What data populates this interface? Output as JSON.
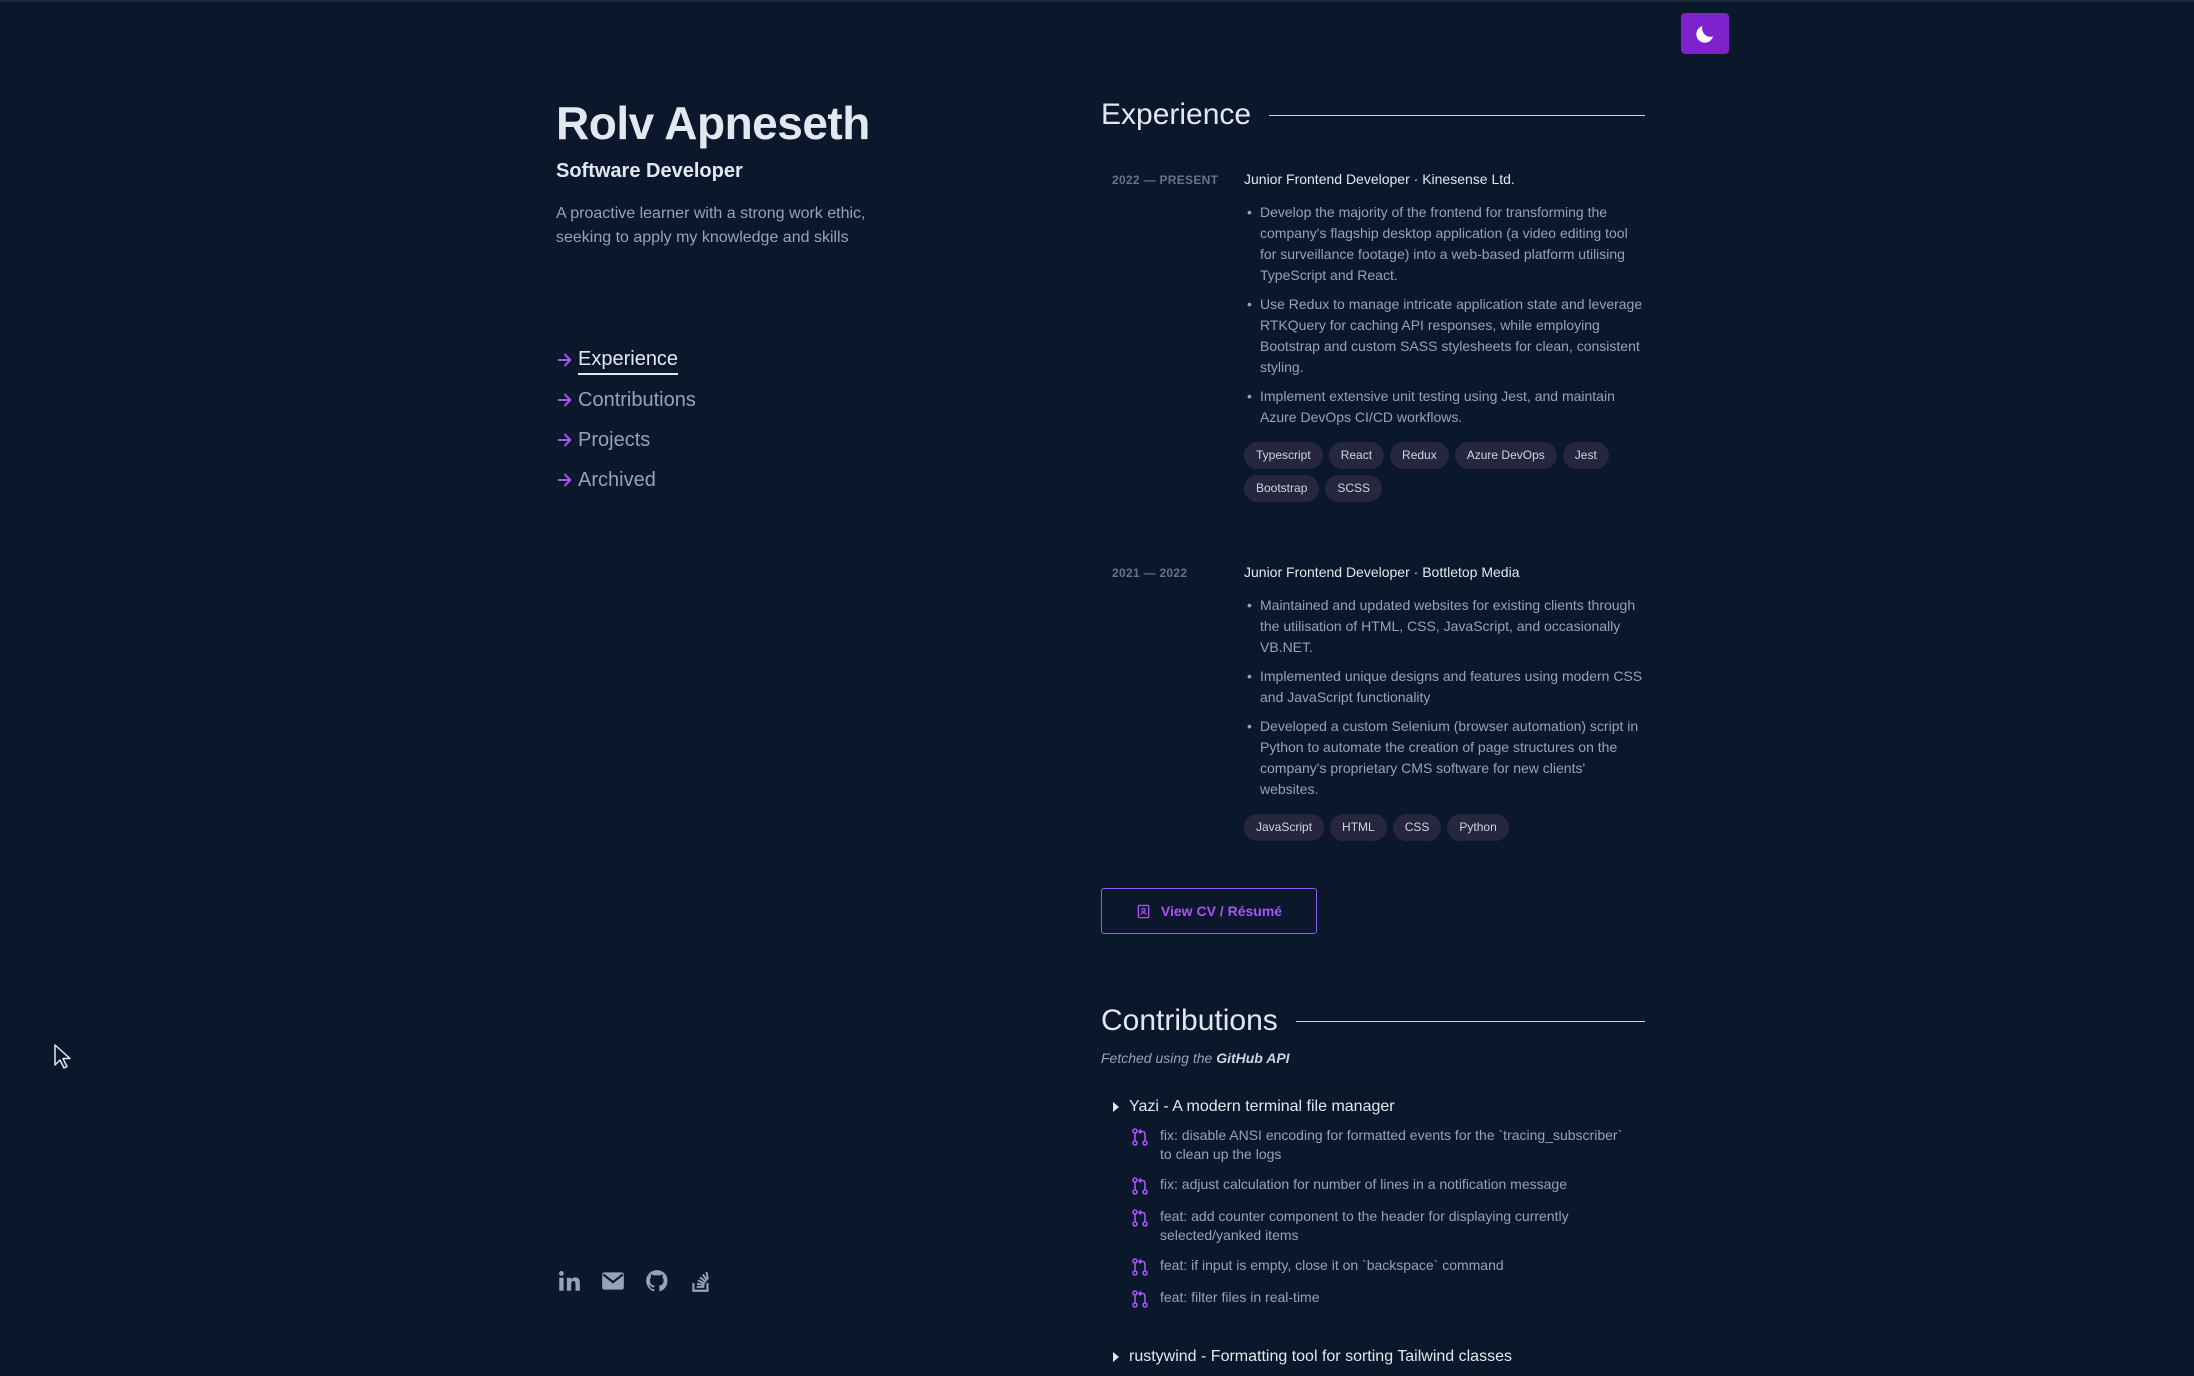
{
  "header": {
    "name": "Rolv Apneseth",
    "role": "Software Developer",
    "bio": "A proactive learner with a strong work ethic, seeking to apply my knowledge and skills",
    "theme_toggle_icon": "moon-icon"
  },
  "nav": {
    "items": [
      {
        "label": "Experience",
        "active": true
      },
      {
        "label": "Contributions",
        "active": false
      },
      {
        "label": "Projects",
        "active": false
      },
      {
        "label": "Archived",
        "active": false
      }
    ]
  },
  "socials": [
    "linkedin-icon",
    "email-icon",
    "github-icon",
    "stackoverflow-icon"
  ],
  "experience": {
    "title": "Experience",
    "jobs": [
      {
        "date": "2022 — PRESENT",
        "title": "Junior Frontend Developer · Kinesense Ltd.",
        "bullets": [
          "Develop the majority of the frontend for transforming the company's flagship desktop application (a video editing tool for surveillance footage) into a web-based platform utilising TypeScript and React.",
          "Use Redux to manage intricate application state and leverage RTKQuery for caching API responses, while employing Bootstrap and custom SASS stylesheets for clean, consistent styling.",
          "Implement extensive unit testing using Jest, and maintain Azure DevOps CI/CD workflows."
        ],
        "tags": [
          "Typescript",
          "React",
          "Redux",
          "Azure DevOps",
          "Jest",
          "Bootstrap",
          "SCSS"
        ]
      },
      {
        "date": "2021 — 2022",
        "title": "Junior Frontend Developer · Bottletop Media",
        "bullets": [
          "Maintained and updated websites for existing clients through the utilisation of HTML, CSS, JavaScript, and occasionally VB.NET.",
          "Implemented unique designs and features using modern CSS and JavaScript functionality",
          "Developed a custom Selenium (browser automation) script in Python to automate the creation of page structures on the company's proprietary CMS software for new clients' websites."
        ],
        "tags": [
          "JavaScript",
          "HTML",
          "CSS",
          "Python"
        ]
      }
    ],
    "cv_button": "View CV / Résumé"
  },
  "contributions": {
    "title": "Contributions",
    "fetched_prefix": "Fetched using the ",
    "fetched_source": "GitHub API",
    "repos": [
      {
        "name": "Yazi - A modern terminal file manager",
        "prs": [
          "fix: disable ANSI encoding for formatted events for the `tracing_subscriber` to clean up the logs",
          "fix: adjust calculation for number of lines in a notification message",
          "feat: add counter component to the header for displaying currently selected/yanked items",
          "feat: if input is empty, close it on `backspace` command",
          "feat: filter files in real-time"
        ]
      },
      {
        "name": "rustywind - Formatting tool for sorting Tailwind classes",
        "prs": []
      }
    ]
  },
  "colors": {
    "background": "#0b172a",
    "accent": "#7e22ce",
    "accent_light": "#a855f7",
    "tag_bg": "#26273f"
  }
}
